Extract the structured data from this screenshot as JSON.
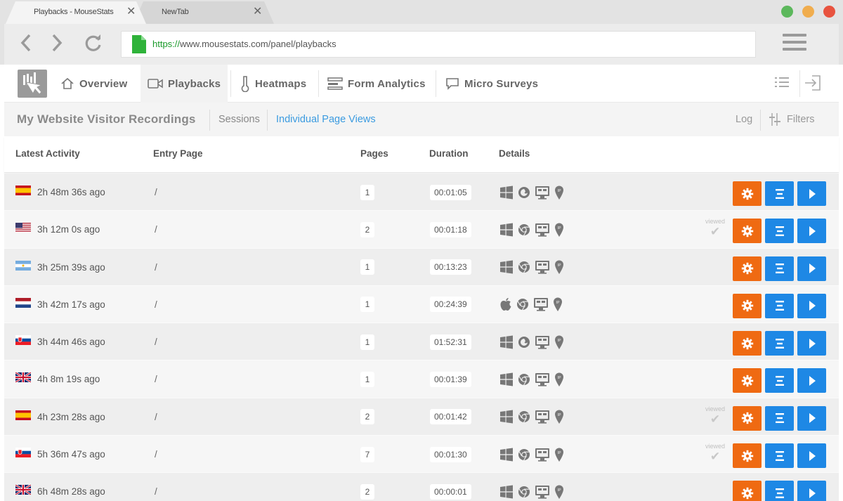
{
  "browser": {
    "tabs": [
      {
        "title": "Playbacks - MouseStats",
        "close": "✕"
      },
      {
        "title": "NewTab",
        "close": "✕"
      }
    ],
    "url_scheme": "https://",
    "url_rest": "www.mousestats.com/panel/playbacks",
    "window_dot_colors": [
      "#5cb85c",
      "#f0ad4e",
      "#e8533f"
    ]
  },
  "nav": {
    "items": [
      {
        "label": "Overview",
        "icon": "home-icon"
      },
      {
        "label": "Playbacks",
        "icon": "camera-icon"
      },
      {
        "label": "Heatmaps",
        "icon": "thermometer-icon"
      },
      {
        "label": "Form Analytics",
        "icon": "form-icon"
      },
      {
        "label": "Micro Surveys",
        "icon": "chat-icon"
      }
    ]
  },
  "subheader": {
    "title": "My Website Visitor Recordings",
    "tabs": [
      "Sessions",
      "Individual Page Views"
    ],
    "log": "Log",
    "filters": "Filters"
  },
  "table": {
    "columns": [
      "Latest Activity",
      "Entry Page",
      "Pages",
      "Duration",
      "Details"
    ],
    "viewed_label": "viewed",
    "rows": [
      {
        "flag": "spain",
        "ago": "2h 48m 36s ago",
        "entry": "/",
        "pages": "1",
        "duration": "00:01:05",
        "os": "windows",
        "browser": "firefox",
        "viewed": false
      },
      {
        "flag": "usa",
        "ago": "3h 12m 0s ago",
        "entry": "/",
        "pages": "2",
        "duration": "00:01:18",
        "os": "windows",
        "browser": "chrome",
        "viewed": true
      },
      {
        "flag": "argentina",
        "ago": "3h 25m 39s ago",
        "entry": "/",
        "pages": "1",
        "duration": "00:13:23",
        "os": "windows",
        "browser": "chrome",
        "viewed": false
      },
      {
        "flag": "netherlands",
        "ago": "3h 42m 17s ago",
        "entry": "/",
        "pages": "1",
        "duration": "00:24:39",
        "os": "apple",
        "browser": "chrome",
        "viewed": false
      },
      {
        "flag": "slovakia",
        "ago": "3h 44m 46s ago",
        "entry": "/",
        "pages": "1",
        "duration": "01:52:31",
        "os": "windows",
        "browser": "firefox",
        "viewed": false
      },
      {
        "flag": "uk",
        "ago": "4h 8m 19s ago",
        "entry": "/",
        "pages": "1",
        "duration": "00:01:39",
        "os": "windows",
        "browser": "chrome",
        "viewed": false
      },
      {
        "flag": "spain",
        "ago": "4h 23m 28s ago",
        "entry": "/",
        "pages": "2",
        "duration": "00:01:42",
        "os": "windows",
        "browser": "chrome",
        "viewed": true
      },
      {
        "flag": "slovakia",
        "ago": "5h 36m 47s ago",
        "entry": "/",
        "pages": "7",
        "duration": "00:01:30",
        "os": "windows",
        "browser": "chrome",
        "viewed": true
      },
      {
        "flag": "uk",
        "ago": "6h 48m 28s ago",
        "entry": "/",
        "pages": "2",
        "duration": "00:00:01",
        "os": "windows",
        "browser": "chrome",
        "viewed": false
      }
    ]
  },
  "colors": {
    "accent_blue": "#1e88e5",
    "accent_orange": "#ef6a12",
    "link_blue": "#3b9be0"
  }
}
